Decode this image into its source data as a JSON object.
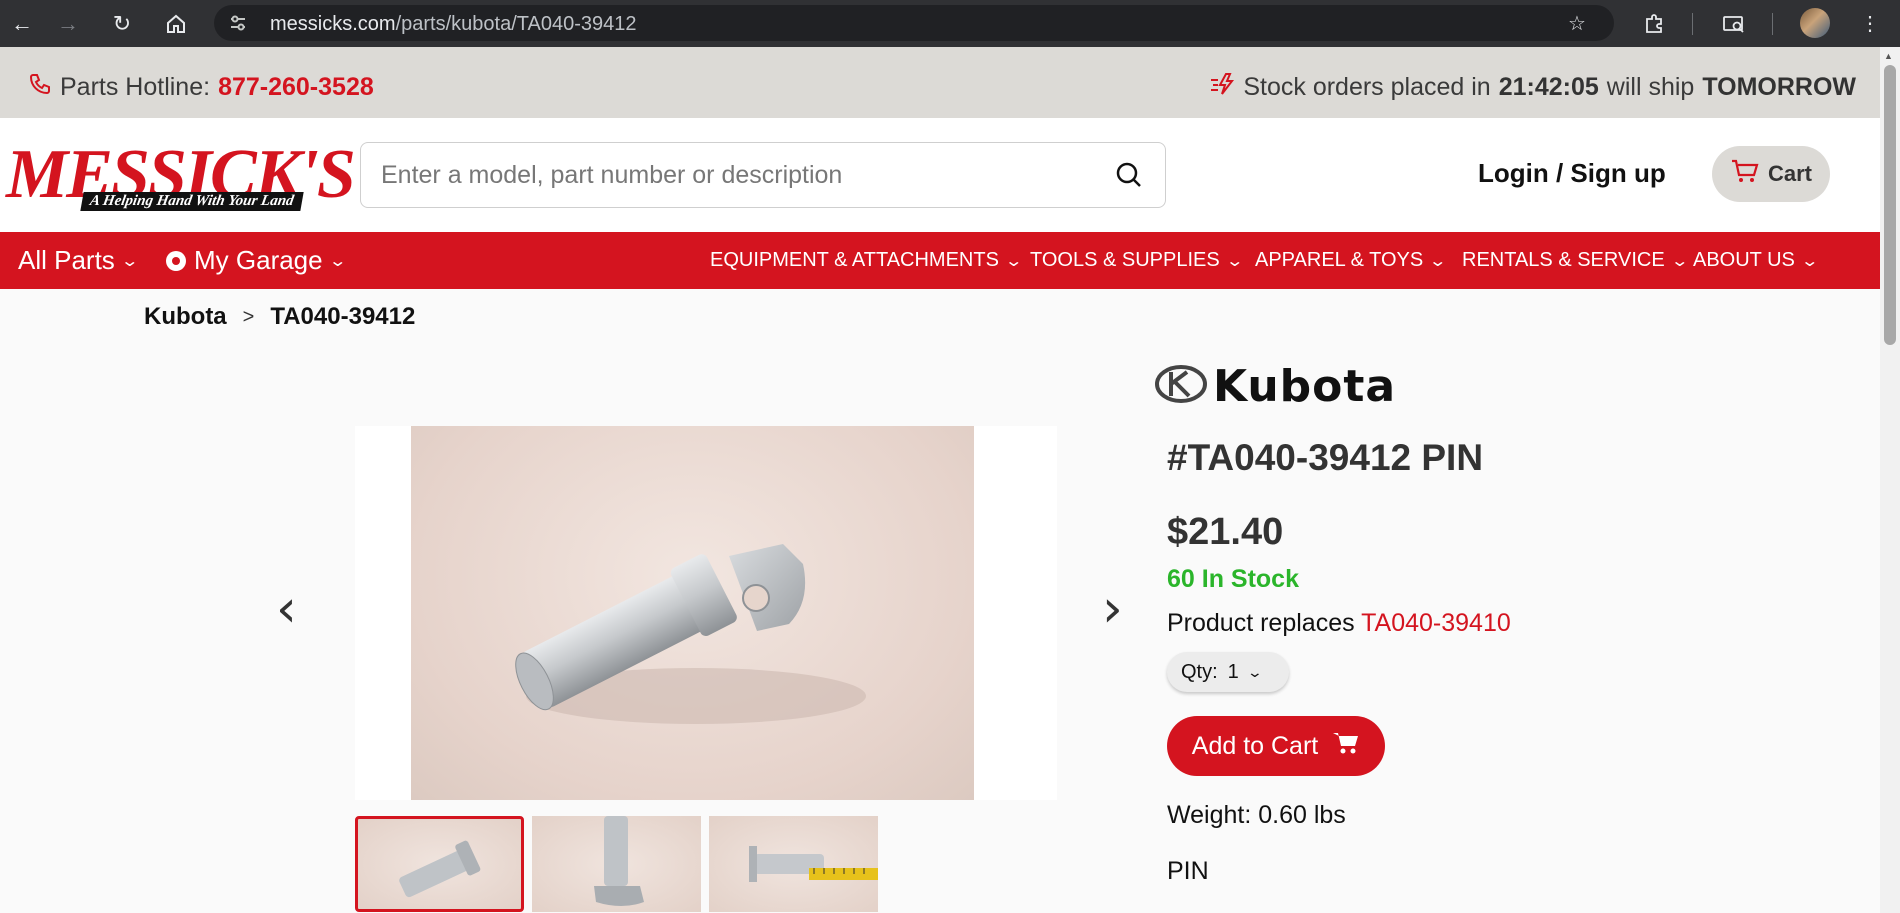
{
  "browser": {
    "url_domain": "messicks.com",
    "url_path": "/parts/kubota/TA040-39412"
  },
  "topbar": {
    "hotline_label": "Parts Hotline:",
    "hotline_number": "877-260-3528",
    "ship_prefix": "Stock orders placed in",
    "ship_timer": "21:42:05",
    "ship_middle": "will ship",
    "ship_day": "TOMORROW"
  },
  "header": {
    "logo_word": "MESSICK'S",
    "logo_tagline": "A Helping Hand With Your Land",
    "search_placeholder": "Enter a model, part number or description",
    "login_label": "Login / Sign up",
    "cart_label": "Cart"
  },
  "nav": {
    "all_parts": "All Parts",
    "my_garage": "My Garage",
    "items": [
      {
        "label": "EQUIPMENT & ATTACHMENTS"
      },
      {
        "label": "TOOLS & SUPPLIES"
      },
      {
        "label": "APPAREL & TOYS"
      },
      {
        "label": "RENTALS & SERVICE"
      },
      {
        "label": "ABOUT US"
      }
    ]
  },
  "breadcrumb": {
    "items": [
      "Kubota",
      "TA040-39412"
    ],
    "separator": ">"
  },
  "product": {
    "brand": "Kubota",
    "title": "#TA040-39412 PIN",
    "price": "$21.40",
    "stock": "60 In Stock",
    "replaces_label": "Product replaces",
    "replaces_part": "TA040-39410",
    "qty_label": "Qty:",
    "qty_value": "1",
    "add_to_cart": "Add to Cart",
    "weight": "Weight: 0.60 lbs",
    "description": "PIN"
  },
  "colors": {
    "brand_red": "#d4141f",
    "stock_green": "#2bb52b",
    "chrome_dark": "#303134"
  }
}
